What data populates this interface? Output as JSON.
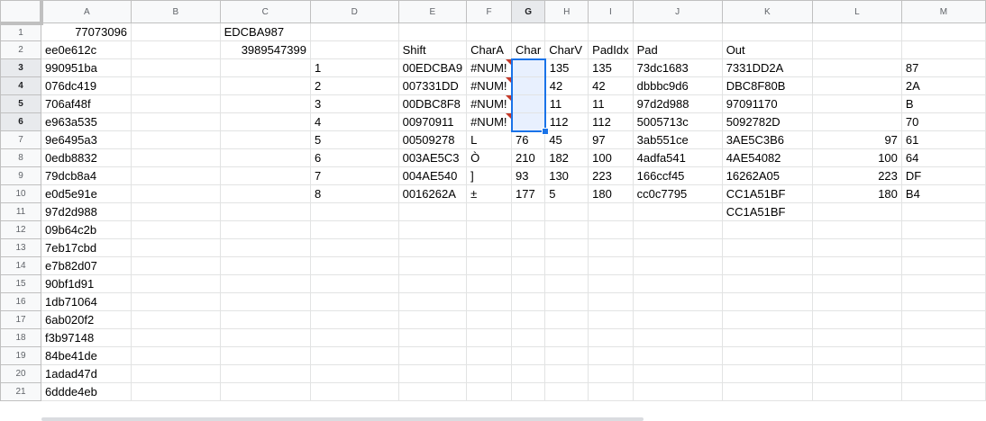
{
  "columns": [
    "A",
    "B",
    "C",
    "D",
    "E",
    "F",
    "G",
    "H",
    "I",
    "J",
    "K",
    "L",
    "M"
  ],
  "rows": [
    {
      "n": "1",
      "A": "77073096",
      "B": "",
      "C": "EDCBA987",
      "D": "",
      "E": "",
      "F": "",
      "G": "",
      "H": "",
      "I": "",
      "J": "",
      "K": "",
      "L": "",
      "M": ""
    },
    {
      "n": "2",
      "A": "ee0e612c",
      "B": "",
      "C": "3989547399",
      "D": "",
      "E": "Shift",
      "F": "CharA",
      "G": "Char",
      "H": "CharV",
      "I": "PadIdx",
      "J": "Pad",
      "K": "Out",
      "L": "",
      "M": ""
    },
    {
      "n": "3",
      "A": "990951ba",
      "B": "",
      "C": "",
      "D": "1",
      "E": "00EDCBA9",
      "F": "#NUM!",
      "G": "",
      "H": "135",
      "I": "135",
      "J": "73dc1683",
      "K": "7331DD2A",
      "L": "",
      "M": "87"
    },
    {
      "n": "4",
      "A": "076dc419",
      "B": "",
      "C": "",
      "D": "2",
      "E": "007331DD",
      "F": "#NUM!",
      "G": "",
      "H": "42",
      "I": "42",
      "J": "dbbbc9d6",
      "K": "DBC8F80B",
      "L": "",
      "M": "2A"
    },
    {
      "n": "5",
      "A": "706af48f",
      "B": "",
      "C": "",
      "D": "3",
      "E": "00DBC8F8",
      "F": "#NUM!",
      "G": "",
      "H": "11",
      "I": "11",
      "J": "97d2d988",
      "K": "97091170",
      "L": "",
      "M": "B"
    },
    {
      "n": "6",
      "A": "e963a535",
      "B": "",
      "C": "",
      "D": "4",
      "E": "00970911",
      "F": "#NUM!",
      "G": "",
      "H": "112",
      "I": "112",
      "J": "5005713c",
      "K": "5092782D",
      "L": "",
      "M": "70"
    },
    {
      "n": "7",
      "A": "9e6495a3",
      "B": "",
      "C": "",
      "D": "5",
      "E": "00509278",
      "F": "L",
      "G": "76",
      "H": "45",
      "I": "97",
      "J": "3ab551ce",
      "K": "3AE5C3B6",
      "L": "97",
      "M": "61"
    },
    {
      "n": "8",
      "A": "0edb8832",
      "B": "",
      "C": "",
      "D": "6",
      "E": "003AE5C3",
      "F": "Ò",
      "G": "210",
      "H": "182",
      "I": "100",
      "J": "4adfa541",
      "K": "4AE54082",
      "L": "100",
      "M": "64"
    },
    {
      "n": "9",
      "A": "79dcb8a4",
      "B": "",
      "C": "",
      "D": "7",
      "E": "004AE540",
      "F": "]",
      "G": "93",
      "H": "130",
      "I": "223",
      "J": "166ccf45",
      "K": "16262A05",
      "L": "223",
      "M": "DF"
    },
    {
      "n": "10",
      "A": "e0d5e91e",
      "B": "",
      "C": "",
      "D": "8",
      "E": "0016262A",
      "F": "±",
      "G": "177",
      "H": "5",
      "I": "180",
      "J": "cc0c7795",
      "K": "CC1A51BF",
      "L": "180",
      "M": "B4"
    },
    {
      "n": "11",
      "A": "97d2d988",
      "B": "",
      "C": "",
      "D": "",
      "E": "",
      "F": "",
      "G": "",
      "H": "",
      "I": "",
      "J": "",
      "K": "CC1A51BF",
      "L": "",
      "M": ""
    },
    {
      "n": "12",
      "A": "09b64c2b",
      "B": "",
      "C": "",
      "D": "",
      "E": "",
      "F": "",
      "G": "",
      "H": "",
      "I": "",
      "J": "",
      "K": "",
      "L": "",
      "M": ""
    },
    {
      "n": "13",
      "A": "7eb17cbd",
      "B": "",
      "C": "",
      "D": "",
      "E": "",
      "F": "",
      "G": "",
      "H": "",
      "I": "",
      "J": "",
      "K": "",
      "L": "",
      "M": ""
    },
    {
      "n": "14",
      "A": "e7b82d07",
      "B": "",
      "C": "",
      "D": "",
      "E": "",
      "F": "",
      "G": "",
      "H": "",
      "I": "",
      "J": "",
      "K": "",
      "L": "",
      "M": ""
    },
    {
      "n": "15",
      "A": "90bf1d91",
      "B": "",
      "C": "",
      "D": "",
      "E": "",
      "F": "",
      "G": "",
      "H": "",
      "I": "",
      "J": "",
      "K": "",
      "L": "",
      "M": ""
    },
    {
      "n": "16",
      "A": "1db71064",
      "B": "",
      "C": "",
      "D": "",
      "E": "",
      "F": "",
      "G": "",
      "H": "",
      "I": "",
      "J": "",
      "K": "",
      "L": "",
      "M": ""
    },
    {
      "n": "17",
      "A": "6ab020f2",
      "B": "",
      "C": "",
      "D": "",
      "E": "",
      "F": "",
      "G": "",
      "H": "",
      "I": "",
      "J": "",
      "K": "",
      "L": "",
      "M": ""
    },
    {
      "n": "18",
      "A": "f3b97148",
      "B": "",
      "C": "",
      "D": "",
      "E": "",
      "F": "",
      "G": "",
      "H": "",
      "I": "",
      "J": "",
      "K": "",
      "L": "",
      "M": ""
    },
    {
      "n": "19",
      "A": "84be41de",
      "B": "",
      "C": "",
      "D": "",
      "E": "",
      "F": "",
      "G": "",
      "H": "",
      "I": "",
      "J": "",
      "K": "",
      "L": "",
      "M": ""
    },
    {
      "n": "20",
      "A": "1adad47d",
      "B": "",
      "C": "",
      "D": "",
      "E": "",
      "F": "",
      "G": "",
      "H": "",
      "I": "",
      "J": "",
      "K": "",
      "L": "",
      "M": ""
    },
    {
      "n": "21",
      "A": "6ddde4eb",
      "B": "",
      "C": "",
      "D": "",
      "E": "",
      "F": "",
      "G": "",
      "H": "",
      "I": "",
      "J": "",
      "K": "",
      "L": "",
      "M": ""
    }
  ],
  "selection": {
    "column": "G",
    "rows": [
      "3",
      "4",
      "5",
      "6"
    ]
  },
  "colors": {
    "accent": "#1a73e8",
    "error": "#c53929",
    "header_bg": "#f8f9fa"
  }
}
